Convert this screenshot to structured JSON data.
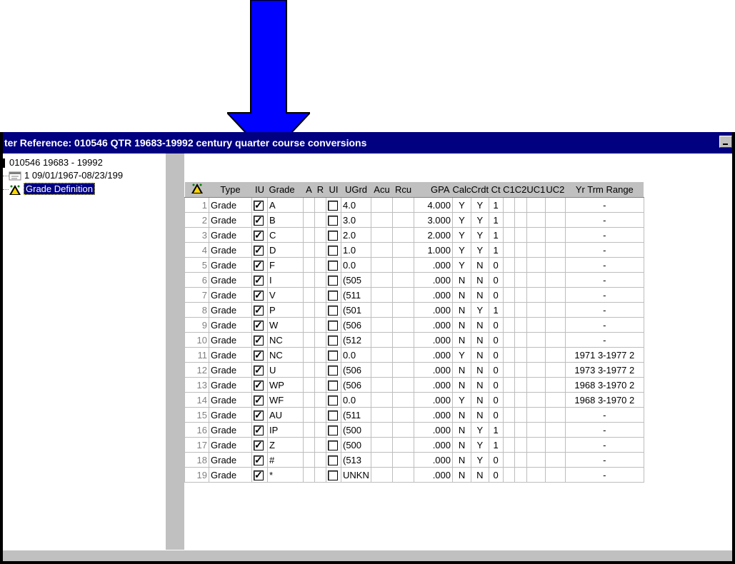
{
  "window": {
    "title": "ter Reference: 010546 QTR 19683-19992 century quarter course conversions"
  },
  "tree": {
    "root_label": "010546   19683 - 19992",
    "child_label": "1  09/01/1967-08/23/199",
    "selected_label": "Grade Definition"
  },
  "grid": {
    "columns": [
      "Type",
      "IU",
      "Grade",
      "A",
      "R",
      "UI",
      "UGrd",
      "Acu",
      "Rcu",
      "GPA",
      "Calc",
      "Crdt",
      "Ct",
      "C1",
      "C2",
      "UC1",
      "UC2",
      "Yr Trm Range"
    ],
    "rows": [
      {
        "n": "1",
        "type": "Grade",
        "iu": true,
        "grade": "A",
        "ui": false,
        "ugrd": "4.0",
        "gpa": "4.000",
        "calc": "Y",
        "crdt": "Y",
        "ct": "1",
        "range": "-"
      },
      {
        "n": "2",
        "type": "Grade",
        "iu": true,
        "grade": "B",
        "ui": false,
        "ugrd": "3.0",
        "gpa": "3.000",
        "calc": "Y",
        "crdt": "Y",
        "ct": "1",
        "range": "-"
      },
      {
        "n": "3",
        "type": "Grade",
        "iu": true,
        "grade": "C",
        "ui": false,
        "ugrd": "2.0",
        "gpa": "2.000",
        "calc": "Y",
        "crdt": "Y",
        "ct": "1",
        "range": "-"
      },
      {
        "n": "4",
        "type": "Grade",
        "iu": true,
        "grade": "D",
        "ui": false,
        "ugrd": "1.0",
        "gpa": "1.000",
        "calc": "Y",
        "crdt": "Y",
        "ct": "1",
        "range": "-"
      },
      {
        "n": "5",
        "type": "Grade",
        "iu": true,
        "grade": "F",
        "ui": false,
        "ugrd": "0.0",
        "gpa": ".000",
        "calc": "Y",
        "crdt": "N",
        "ct": "0",
        "range": "-"
      },
      {
        "n": "6",
        "type": "Grade",
        "iu": true,
        "grade": "I",
        "ui": false,
        "ugrd": "(505",
        "gpa": ".000",
        "calc": "N",
        "crdt": "N",
        "ct": "0",
        "range": "-"
      },
      {
        "n": "7",
        "type": "Grade",
        "iu": true,
        "grade": "V",
        "ui": false,
        "ugrd": "(511",
        "gpa": ".000",
        "calc": "N",
        "crdt": "N",
        "ct": "0",
        "range": "-"
      },
      {
        "n": "8",
        "type": "Grade",
        "iu": true,
        "grade": "P",
        "ui": false,
        "ugrd": "(501",
        "gpa": ".000",
        "calc": "N",
        "crdt": "Y",
        "ct": "1",
        "range": "-"
      },
      {
        "n": "9",
        "type": "Grade",
        "iu": true,
        "grade": "W",
        "ui": false,
        "ugrd": "(506",
        "gpa": ".000",
        "calc": "N",
        "crdt": "N",
        "ct": "0",
        "range": "-"
      },
      {
        "n": "10",
        "type": "Grade",
        "iu": true,
        "grade": "NC",
        "ui": false,
        "ugrd": "(512",
        "gpa": ".000",
        "calc": "N",
        "crdt": "N",
        "ct": "0",
        "range": "-"
      },
      {
        "n": "11",
        "type": "Grade",
        "iu": true,
        "grade": "NC",
        "ui": false,
        "ugrd": "0.0",
        "gpa": ".000",
        "calc": "Y",
        "crdt": "N",
        "ct": "0",
        "range": "1971 3-1977 2"
      },
      {
        "n": "12",
        "type": "Grade",
        "iu": true,
        "grade": "U",
        "ui": false,
        "ugrd": "(506",
        "gpa": ".000",
        "calc": "N",
        "crdt": "N",
        "ct": "0",
        "range": "1973 3-1977 2"
      },
      {
        "n": "13",
        "type": "Grade",
        "iu": true,
        "grade": "WP",
        "ui": false,
        "ugrd": "(506",
        "gpa": ".000",
        "calc": "N",
        "crdt": "N",
        "ct": "0",
        "range": "1968 3-1970 2"
      },
      {
        "n": "14",
        "type": "Grade",
        "iu": true,
        "grade": "WF",
        "ui": false,
        "ugrd": "0.0",
        "gpa": ".000",
        "calc": "Y",
        "crdt": "N",
        "ct": "0",
        "range": "1968 3-1970 2"
      },
      {
        "n": "15",
        "type": "Grade",
        "iu": true,
        "grade": "AU",
        "ui": false,
        "ugrd": "(511",
        "gpa": ".000",
        "calc": "N",
        "crdt": "N",
        "ct": "0",
        "range": "-"
      },
      {
        "n": "16",
        "type": "Grade",
        "iu": true,
        "grade": "IP",
        "ui": false,
        "ugrd": "(500",
        "gpa": ".000",
        "calc": "N",
        "crdt": "Y",
        "ct": "1",
        "range": "-"
      },
      {
        "n": "17",
        "type": "Grade",
        "iu": true,
        "grade": "Z",
        "ui": false,
        "ugrd": "(500",
        "gpa": ".000",
        "calc": "N",
        "crdt": "Y",
        "ct": "1",
        "range": "-"
      },
      {
        "n": "18",
        "type": "Grade",
        "iu": true,
        "grade": "#",
        "ui": false,
        "ugrd": "(513",
        "gpa": ".000",
        "calc": "N",
        "crdt": "Y",
        "ct": "0",
        "range": "-"
      },
      {
        "n": "19",
        "type": "Grade",
        "iu": true,
        "grade": "*",
        "ui": false,
        "ugrd": "UNKN",
        "gpa": ".000",
        "calc": "N",
        "crdt": "N",
        "ct": "0",
        "range": "-"
      }
    ]
  },
  "colors": {
    "titlebar": "#000080",
    "arrow": "#0000ff",
    "chrome": "#c0c0c0"
  },
  "icons": {
    "arrow": "down-arrow-icon",
    "tree_root": "folder-icon",
    "tree_child": "document-icon",
    "grade_definition": "tree-node-icon",
    "grid_corner": "tree-node-icon"
  }
}
